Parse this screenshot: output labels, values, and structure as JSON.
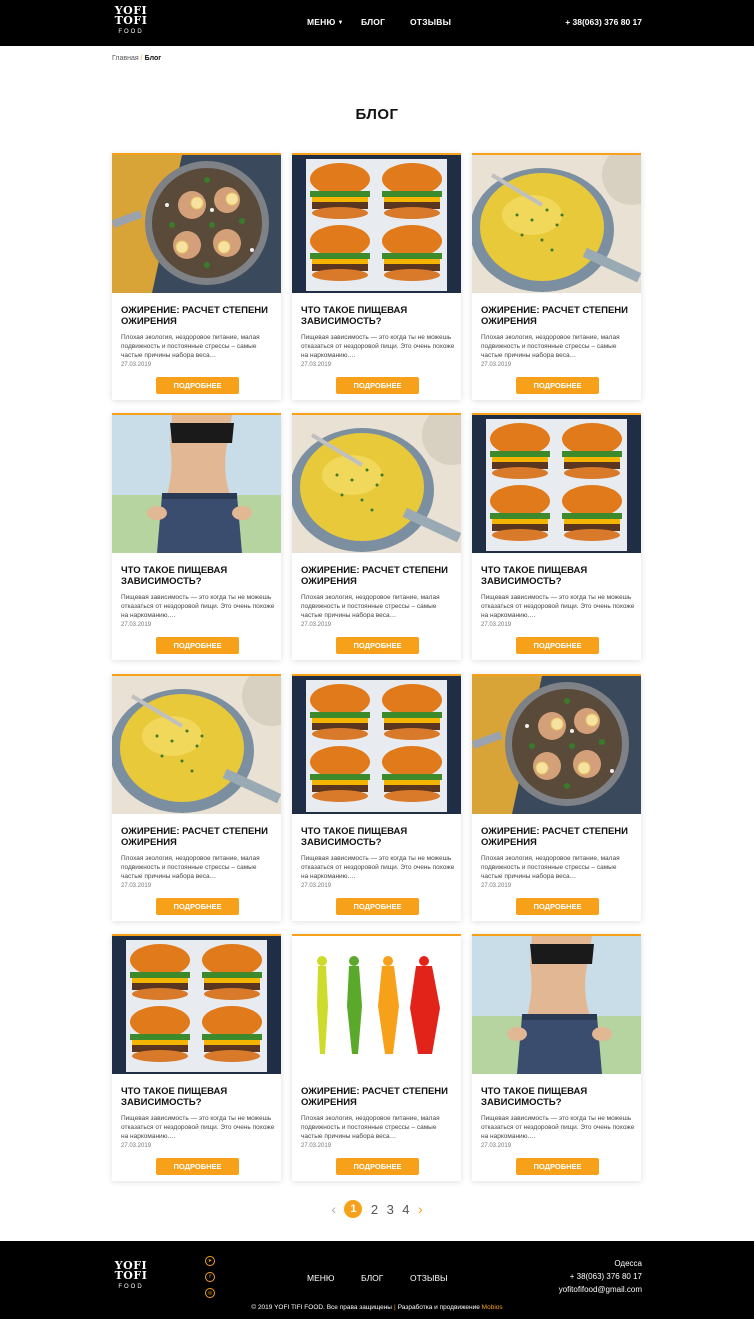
{
  "brand": {
    "line1": "YOFI",
    "line2": "TOFI",
    "line3": "FOOD"
  },
  "header": {
    "nav": {
      "menu": "МЕНЮ",
      "blog": "БЛОГ",
      "reviews": "ОТЗЫВЫ"
    },
    "phone": "+ 38(063) 376 80 17"
  },
  "breadcrumb": {
    "home": "Главная",
    "separator": "/",
    "current": "Блог"
  },
  "page_title": "БЛОГ",
  "cards": [
    {
      "image": "chicken-pan",
      "title": "ОЖИРЕНИЕ: РАСЧЕТ СТЕПЕНИ ОЖИРЕНИЯ",
      "excerpt": "Плохая экология, нездоровое питание, малая подвижность и постоянные стрессы – самые частые причины набора веса…",
      "date": "27.03.2019",
      "button": "ПОДРОБНЕЕ"
    },
    {
      "image": "burgers",
      "title": "ЧТО ТАКОЕ ПИЩЕВАЯ ЗАВИСИМОСТЬ?",
      "excerpt": "Пищевая зависимость — это когда ты не можешь отказаться от нездоровой пищи. Это очень похоже на наркоманию.…",
      "date": "27.03.2019",
      "button": "ПОДРОБНЕЕ"
    },
    {
      "image": "soup-pot",
      "title": "ОЖИРЕНИЕ: РАСЧЕТ СТЕПЕНИ ОЖИРЕНИЯ",
      "excerpt": "Плохая экология, нездоровое питание, малая подвижность и постоянные стрессы – самые частые причины набора веса…",
      "date": "27.03.2019",
      "button": "ПОДРОБНЕЕ"
    },
    {
      "image": "waist",
      "title": "ЧТО ТАКОЕ ПИЩЕВАЯ ЗАВИСИМОСТЬ?",
      "excerpt": "Пищевая зависимость — это когда ты не можешь отказаться от нездоровой пищи. Это очень похоже на наркоманию.…",
      "date": "27.03.2019",
      "button": "ПОДРОБНЕЕ"
    },
    {
      "image": "soup-pot",
      "title": "ОЖИРЕНИЕ: РАСЧЕТ СТЕПЕНИ ОЖИРЕНИЯ",
      "excerpt": "Плохая экология, нездоровое питание, малая подвижность и постоянные стрессы – самые частые причины набора веса…",
      "date": "27.03.2019",
      "button": "ПОДРОБНЕЕ"
    },
    {
      "image": "burgers",
      "title": "ЧТО ТАКОЕ ПИЩЕВАЯ ЗАВИСИМОСТЬ?",
      "excerpt": "Пищевая зависимость — это когда ты не можешь отказаться от нездоровой пищи. Это очень похоже на наркоманию.…",
      "date": "27.03.2019",
      "button": "ПОДРОБНЕЕ"
    },
    {
      "image": "soup-pot",
      "title": "ОЖИРЕНИЕ: РАСЧЕТ СТЕПЕНИ ОЖИРЕНИЯ",
      "excerpt": "Плохая экология, нездоровое питание, малая подвижность и постоянные стрессы – самые частые причины набора веса…",
      "date": "27.03.2019",
      "button": "ПОДРОБНЕЕ"
    },
    {
      "image": "burgers",
      "title": "ЧТО ТАКОЕ ПИЩЕВАЯ ЗАВИСИМОСТЬ?",
      "excerpt": "Пищевая зависимость — это когда ты не можешь отказаться от нездоровой пищи. Это очень похоже на наркоманию.…",
      "date": "27.03.2019",
      "button": "ПОДРОБНЕЕ"
    },
    {
      "image": "chicken-pan",
      "title": "ОЖИРЕНИЕ: РАСЧЕТ СТЕПЕНИ ОЖИРЕНИЯ",
      "excerpt": "Плохая экология, нездоровое питание, малая подвижность и постоянные стрессы – самые частые причины набора веса…",
      "date": "27.03.2019",
      "button": "ПОДРОБНЕЕ"
    },
    {
      "image": "burgers",
      "title": "ЧТО ТАКОЕ ПИЩЕВАЯ ЗАВИСИМОСТЬ?",
      "excerpt": "Пищевая зависимость — это когда ты не можешь отказаться от нездоровой пищи. Это очень похоже на наркоманию.…",
      "date": "27.03.2019",
      "button": "ПОДРОБНЕЕ"
    },
    {
      "image": "body-silhouettes",
      "title": "ОЖИРЕНИЕ: РАСЧЕТ СТЕПЕНИ ОЖИРЕНИЯ",
      "excerpt": "Плохая экология, нездоровое питание, малая подвижность и постоянные стрессы – самые частые причины набора веса…",
      "date": "27.03.2019",
      "button": "ПОДРОБНЕЕ"
    },
    {
      "image": "waist",
      "title": "ЧТО ТАКОЕ ПИЩЕВАЯ ЗАВИСИМОСТЬ?",
      "excerpt": "Пищевая зависимость — это когда ты не можешь отказаться от нездоровой пищи. Это очень похоже на наркоманию.…",
      "date": "27.03.2019",
      "button": "ПОДРОБНЕЕ"
    }
  ],
  "pagination": {
    "prev": "‹",
    "pages": [
      "1",
      "2",
      "3",
      "4"
    ],
    "current": "1",
    "next": "›"
  },
  "footer": {
    "nav": {
      "menu": "МЕНЮ",
      "blog": "БЛОГ",
      "reviews": "ОТЗЫВЫ"
    },
    "social": [
      "telegram-icon",
      "facebook-icon",
      "instagram-icon"
    ],
    "city": "Одесса",
    "phone": "+ 38(063) 376 80 17",
    "email": "yofitofifood@gmail.com",
    "copyright": "© 2019 YOFI TIFI FOOD. Все права защищены",
    "separator": "|",
    "dev_text": "Разработка и продвижение",
    "dev_brand": "Mobios"
  },
  "colors": {
    "accent": "#f7a11a",
    "header_bg": "#000000",
    "footer_bg": "#000000"
  }
}
